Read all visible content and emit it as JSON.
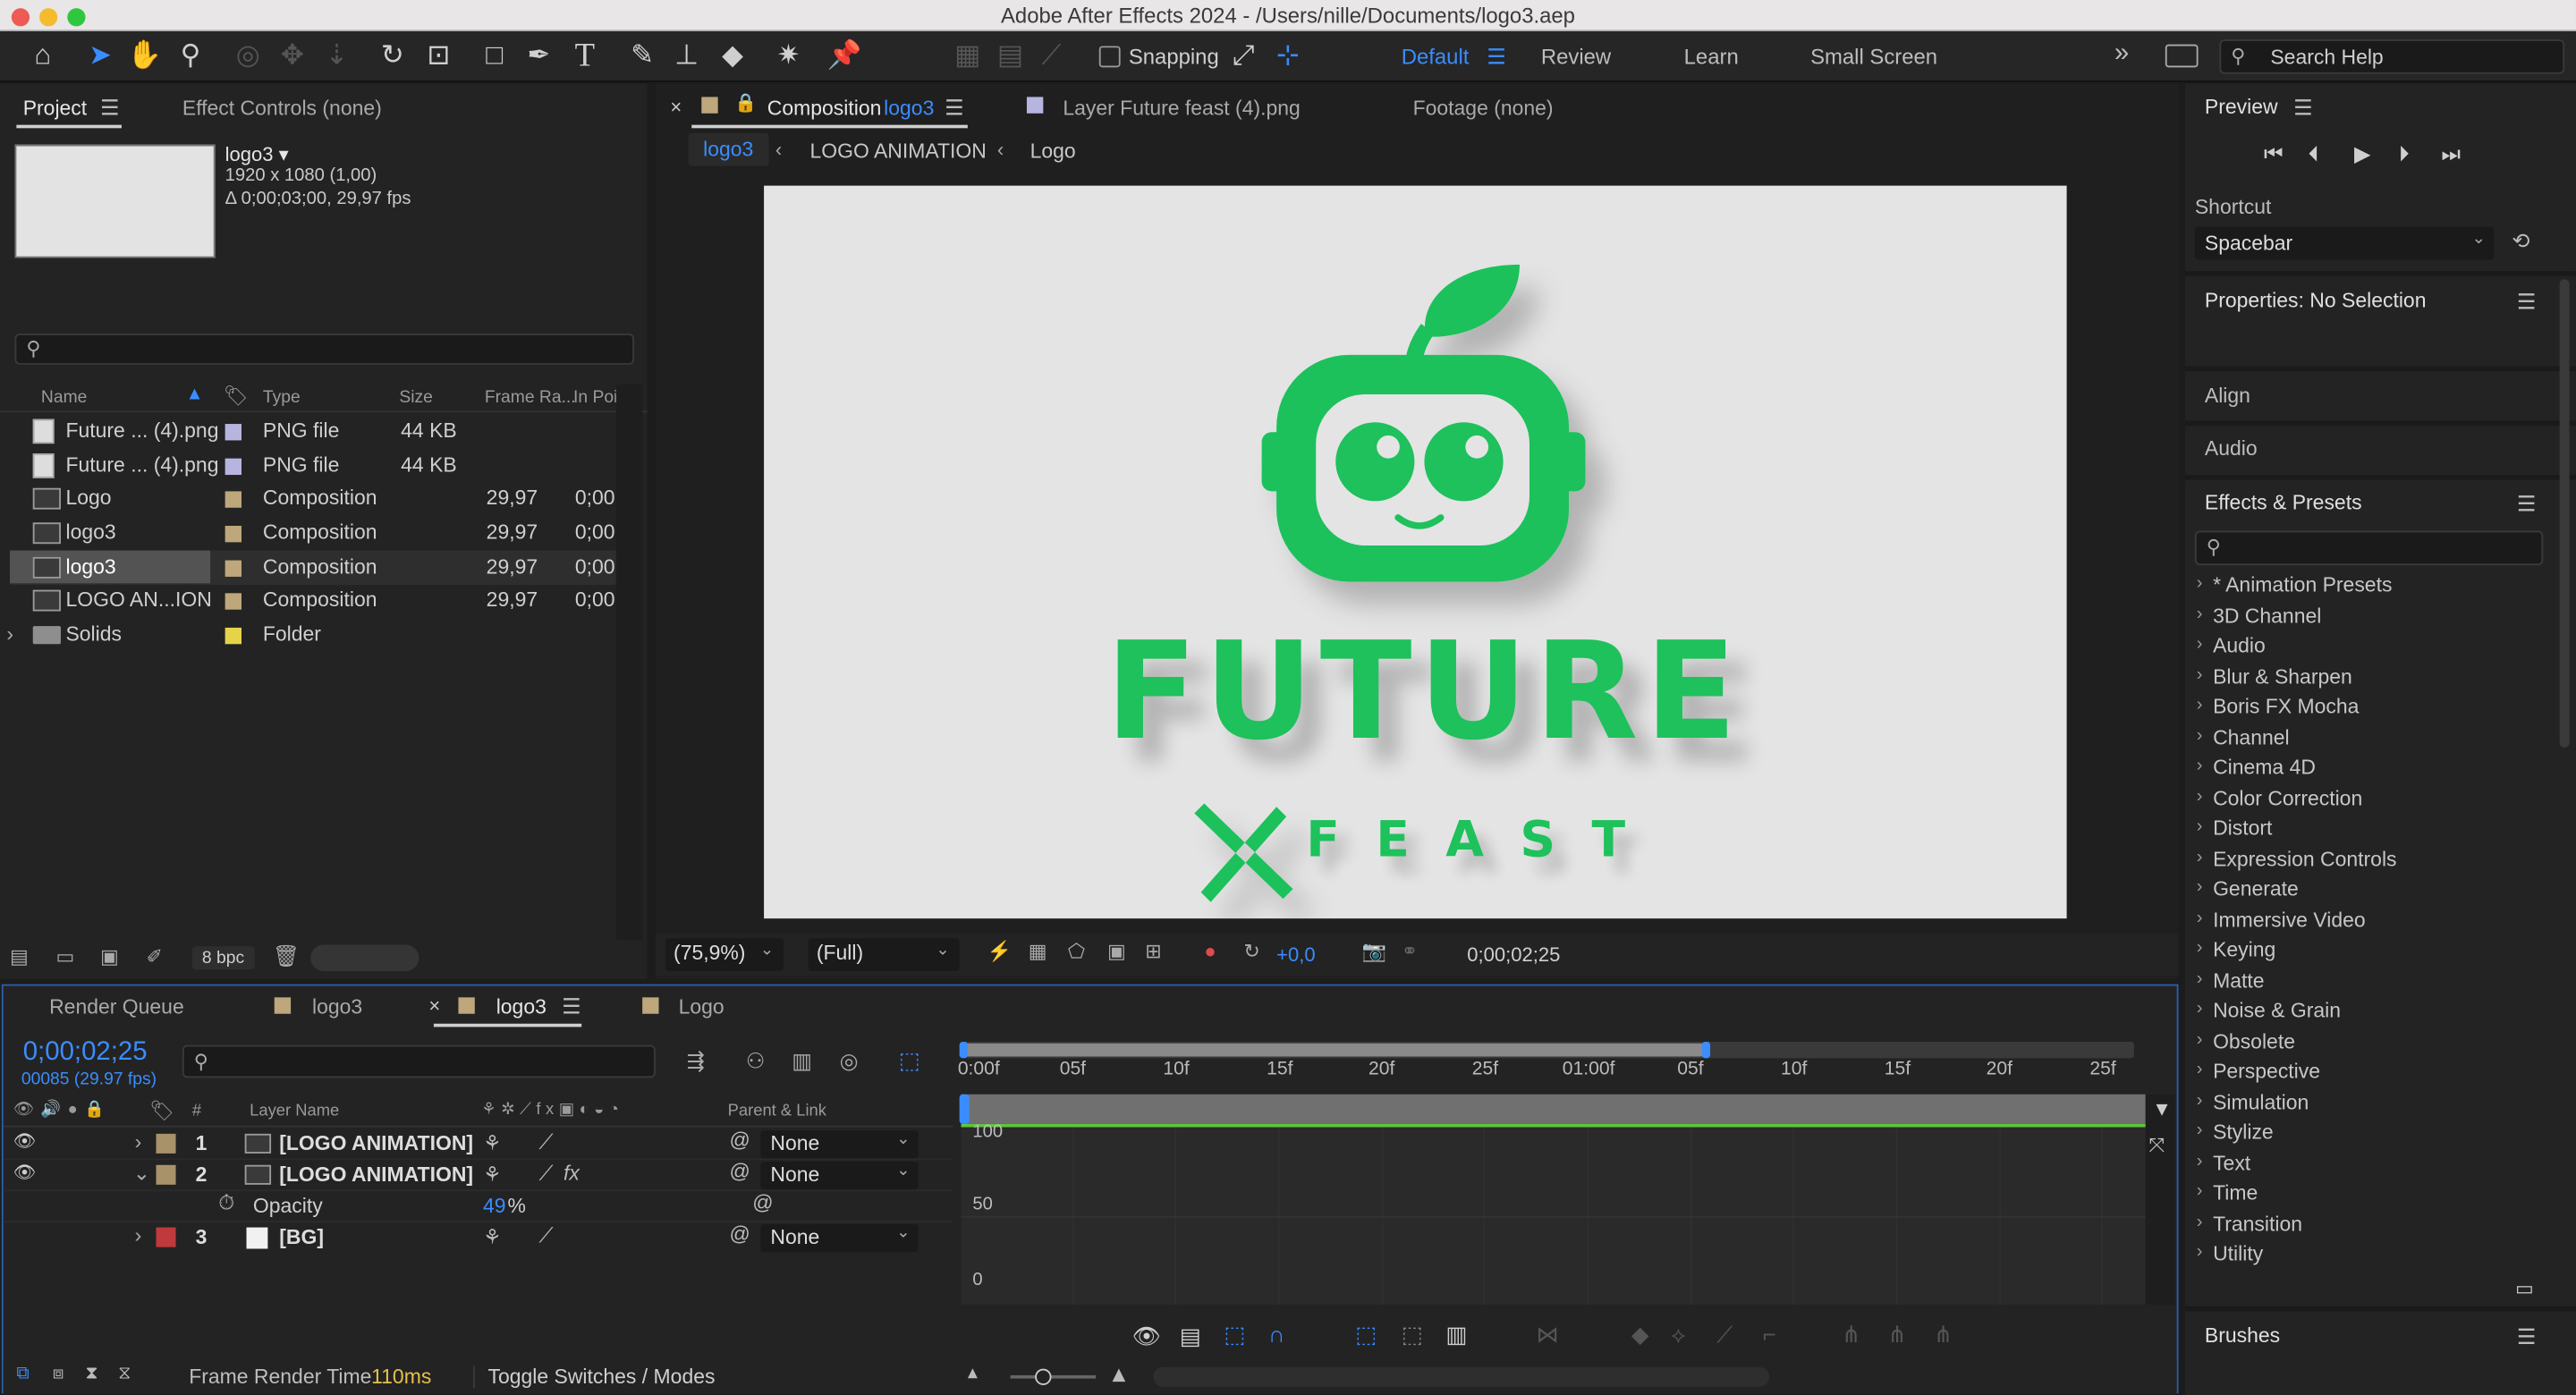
{
  "window": {
    "title": "Adobe After Effects 2024 - /Users/nille/Documents/logo3.aep"
  },
  "toolbar": {
    "snapping_label": "Snapping",
    "workspaces": [
      "Default",
      "Review",
      "Learn",
      "Small Screen"
    ],
    "search_placeholder": "Search Help"
  },
  "project": {
    "tab": "Project",
    "effect_controls_tab": "Effect Controls (none)",
    "selected": {
      "name": "logo3 ▾",
      "size": "1920 x 1080 (1,00)",
      "duration": "Δ 0;00;03;00, 29,97 fps"
    },
    "columns": {
      "name": "Name",
      "type": "Type",
      "size": "Size",
      "frame_rate": "Frame Ra...",
      "in_point": "In Point"
    },
    "items": [
      {
        "name": "Future ... (4).png",
        "type": "PNG file",
        "size": "44 KB",
        "fps": "",
        "in": ""
      },
      {
        "name": "Future ... (4).png",
        "type": "PNG file",
        "size": "44 KB",
        "fps": "",
        "in": ""
      },
      {
        "name": "Logo",
        "type": "Composition",
        "size": "",
        "fps": "29,97",
        "in": "0;00"
      },
      {
        "name": "logo3",
        "type": "Composition",
        "size": "",
        "fps": "29,97",
        "in": "0;00"
      },
      {
        "name": "logo3",
        "type": "Composition",
        "size": "",
        "fps": "29,97",
        "in": "0;00"
      },
      {
        "name": "LOGO AN...ION",
        "type": "Composition",
        "size": "",
        "fps": "29,97",
        "in": "0;00"
      },
      {
        "name": "Solids",
        "type": "Folder",
        "size": "",
        "fps": "",
        "in": ""
      }
    ],
    "bpc": "8 bpc"
  },
  "composition": {
    "tab_label": "Composition",
    "tab_comp": "logo3",
    "layer_tab": "Layer Future feast (4).png",
    "footage_tab": "Footage (none)",
    "breadcrumbs": [
      "logo3",
      "LOGO ANIMATION",
      "Logo"
    ],
    "logo_word": "FUTURE",
    "logo_sub": "FEAST",
    "brand_color": "#1ec15c",
    "zoom": "(75,9%)",
    "resolution": "(Full)",
    "exposure": "+0,0",
    "timecode": "0;00;02;25"
  },
  "preview": {
    "title": "Preview",
    "shortcut_label": "Shortcut",
    "shortcut_value": "Spacebar",
    "properties": "Properties: No Selection",
    "align": "Align",
    "audio": "Audio",
    "effects_title": "Effects & Presets",
    "effects": [
      "* Animation Presets",
      "3D Channel",
      "Audio",
      "Blur & Sharpen",
      "Boris FX Mocha",
      "Channel",
      "Cinema 4D",
      "Color Correction",
      "Distort",
      "Expression Controls",
      "Generate",
      "Immersive Video",
      "Keying",
      "Matte",
      "Noise & Grain",
      "Obsolete",
      "Perspective",
      "Simulation",
      "Stylize",
      "Text",
      "Time",
      "Transition",
      "Utility"
    ],
    "brushes": "Brushes"
  },
  "timeline": {
    "tabs": [
      "Render Queue",
      "logo3",
      "logo3",
      "Logo"
    ],
    "timecode": "0;00;02;25",
    "frames": "00085 (29.97 fps)",
    "col_num": "#",
    "col_layer": "Layer Name",
    "col_parent": "Parent & Link",
    "layers": [
      {
        "num": "1",
        "name": "[LOGO ANIMATION]",
        "parent": "None",
        "color": "#a7926a"
      },
      {
        "num": "2",
        "name": "[LOGO ANIMATION]",
        "parent": "None",
        "color": "#a7926a"
      },
      {
        "num": "3",
        "name": "[BG]",
        "parent": "None",
        "color": "#c0393c"
      }
    ],
    "opacity_label": "Opacity",
    "opacity_value": "49",
    "opacity_unit": "%",
    "ruler": [
      "0:00f",
      "05f",
      "10f",
      "15f",
      "20f",
      "25f",
      "01:00f",
      "05f",
      "10f",
      "15f",
      "20f",
      "25f"
    ],
    "graph_labels": [
      "100",
      "50",
      "0"
    ],
    "render_label": "Frame Render Time",
    "render_value": "110ms",
    "toggle": "Toggle Switches / Modes"
  }
}
